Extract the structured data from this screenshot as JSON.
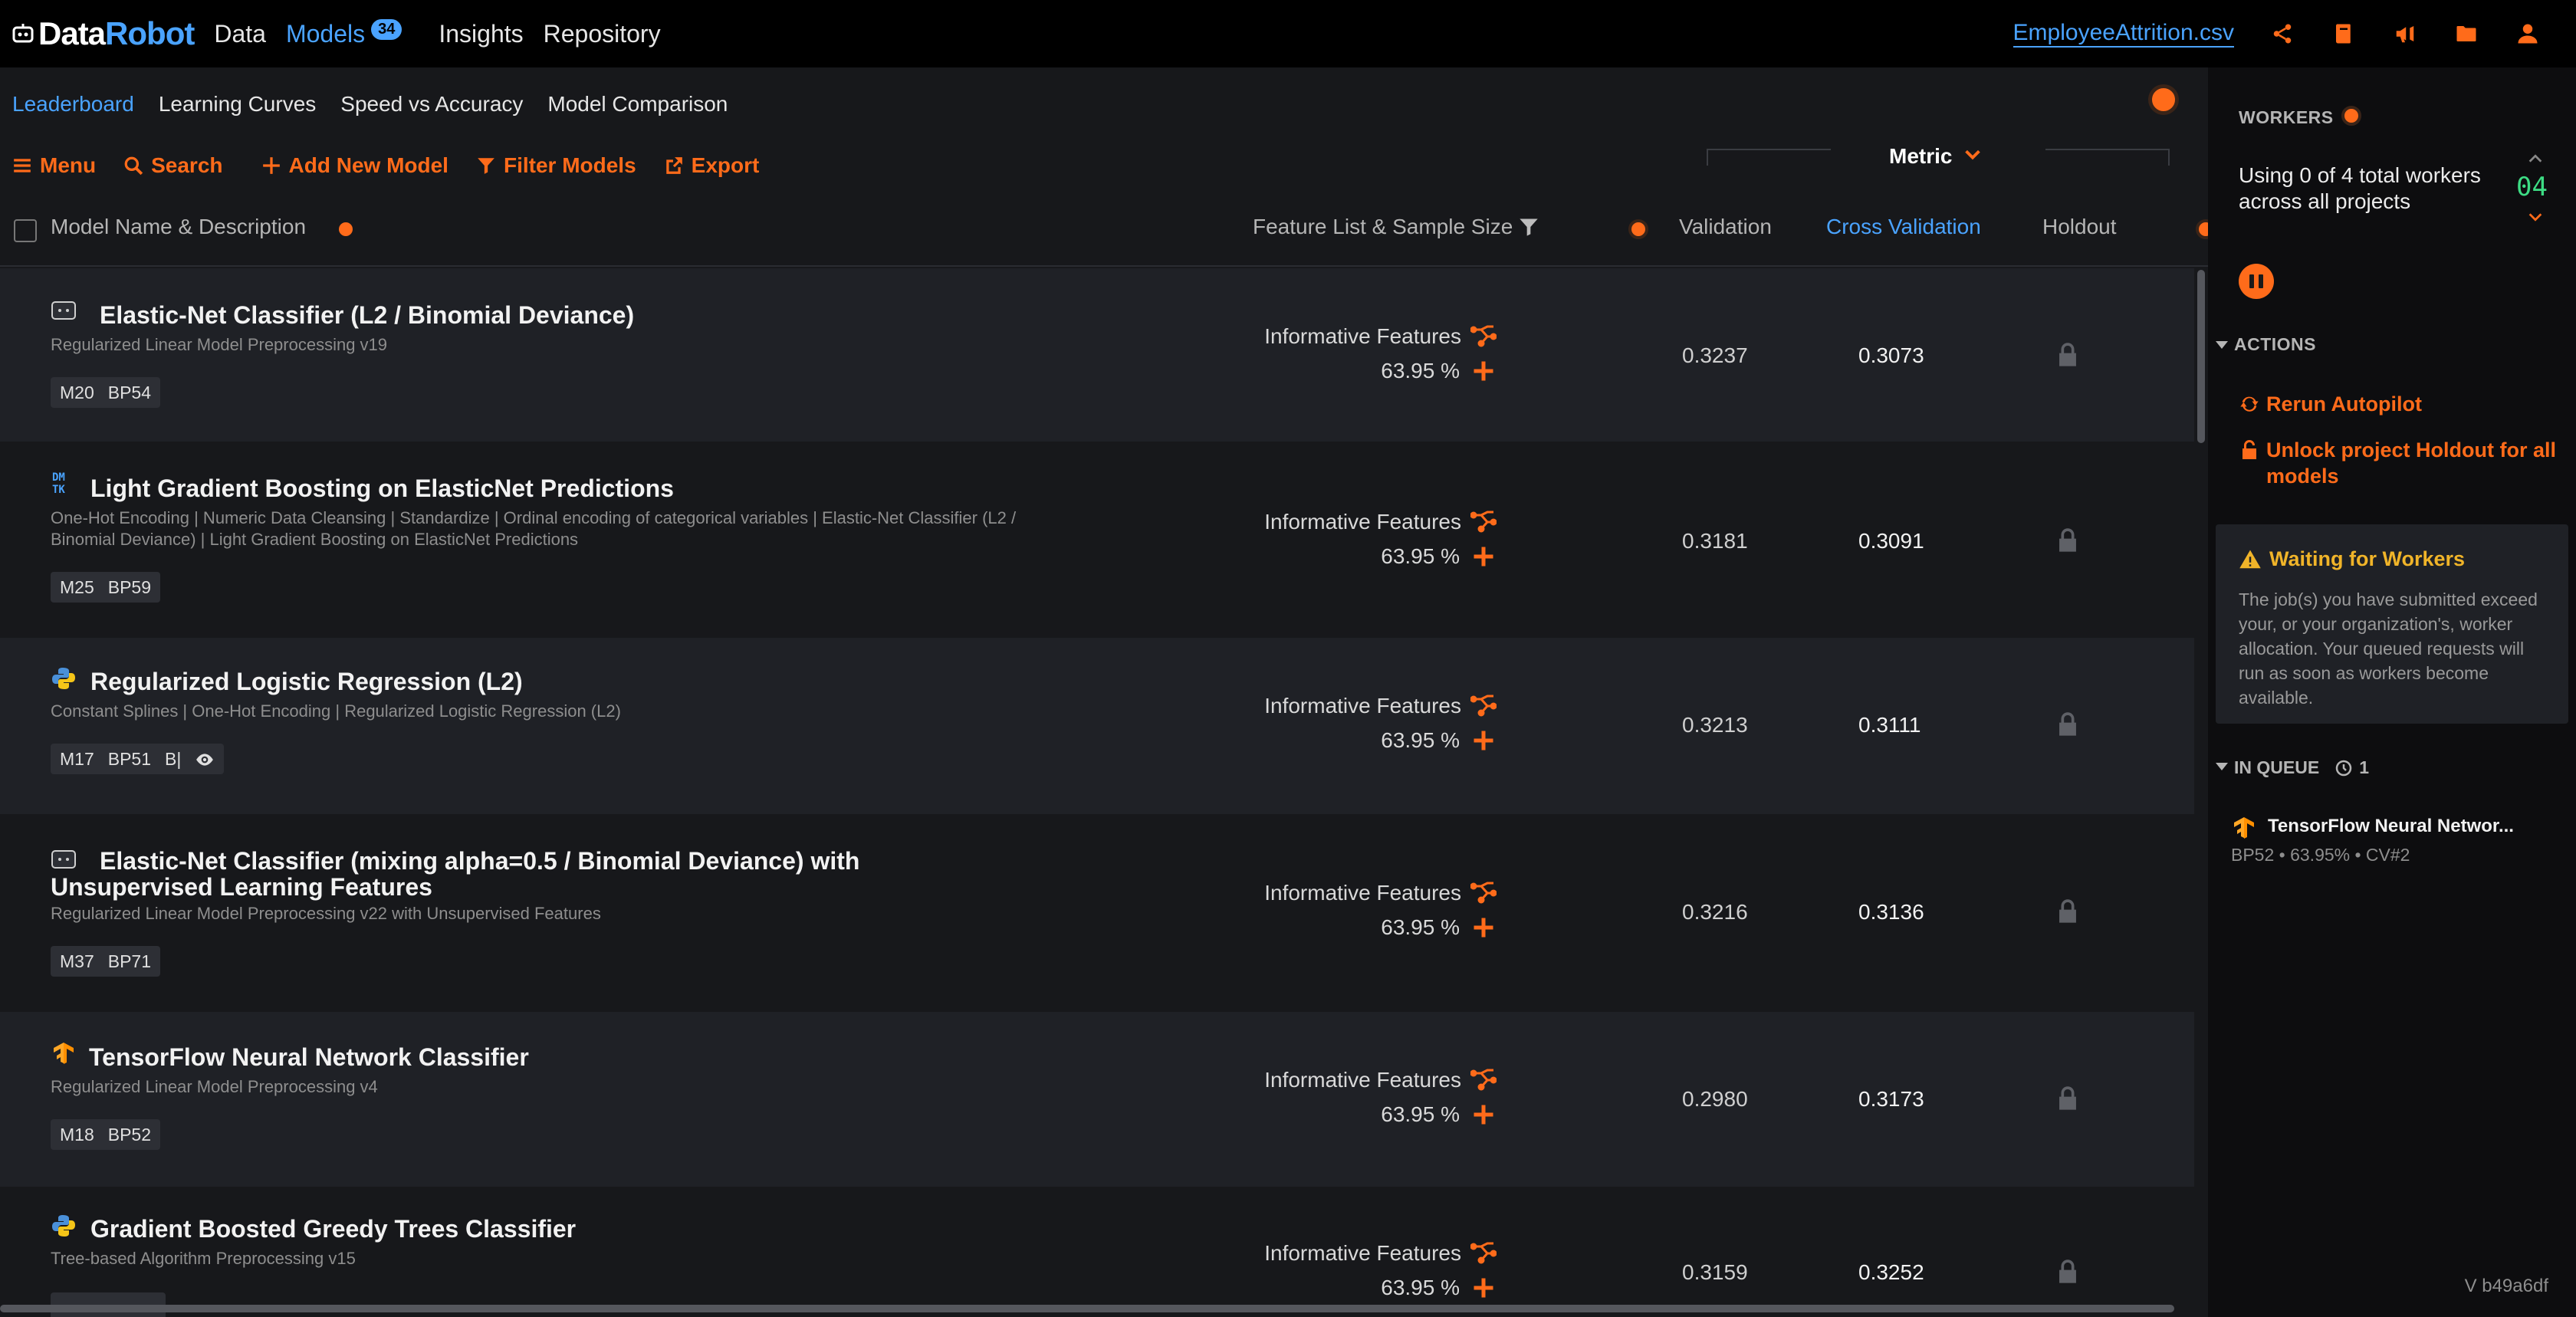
{
  "app": {
    "logo_part1": "Data",
    "logo_part2": "Robot",
    "nav": [
      {
        "label": "Data"
      },
      {
        "label": "Models",
        "badge": "34"
      },
      {
        "label": "Insights"
      },
      {
        "label": "Repository"
      }
    ],
    "project_name": "EmployeeAttrition.csv",
    "top_icons": [
      "share-icon",
      "book-icon",
      "megaphone-icon",
      "folder-icon",
      "user-icon"
    ]
  },
  "subtabs": [
    "Leaderboard",
    "Learning Curves",
    "Speed vs Accuracy",
    "Model Comparison"
  ],
  "toolbar": {
    "menu": "Menu",
    "search": "Search",
    "add_model": "Add New Model",
    "filter": "Filter Models",
    "export": "Export",
    "metric": "Metric"
  },
  "table": {
    "headers": {
      "name": "Model Name & Description",
      "feature": "Feature List & Sample Size",
      "validation": "Validation",
      "cross_validation": "Cross Validation",
      "holdout": "Holdout"
    },
    "rows": [
      {
        "icon": "blueprint-icon",
        "name": "Elastic-Net Classifier (L2 / Binomial Deviance)",
        "description": "Regularized Linear Model Preprocessing v19",
        "tags": [
          "M20",
          "BP54"
        ],
        "feature_list": "Informative Features",
        "sample": "63.95 %",
        "validation": "0.3237",
        "cv": "0.3073"
      },
      {
        "icon": "dmtk-icon",
        "name": "Light Gradient Boosting on ElasticNet Predictions",
        "description": "One-Hot Encoding | Numeric Data Cleansing | Standardize | Ordinal encoding of categorical variables | Elastic-Net Classifier (L2 / Binomial Deviance) | Light Gradient Boosting on ElasticNet Predictions",
        "tags": [
          "M25",
          "BP59"
        ],
        "feature_list": "Informative Features",
        "sample": "63.95 %",
        "validation": "0.3181",
        "cv": "0.3091"
      },
      {
        "icon": "python-icon",
        "name": "Regularized Logistic Regression (L2)",
        "description": "Constant Splines | One-Hot Encoding | Regularized Logistic Regression (L2)",
        "tags": [
          "M17",
          "BP51",
          "B|"
        ],
        "feature_list": "Informative Features",
        "sample": "63.95 %",
        "validation": "0.3213",
        "cv": "0.3111"
      },
      {
        "icon": "blueprint-icon",
        "name": "Elastic-Net Classifier (mixing alpha=0.5 / Binomial Deviance) with Unsupervised Learning Features",
        "description": "Regularized Linear Model Preprocessing v22 with Unsupervised Features",
        "tags": [
          "M37",
          "BP71"
        ],
        "feature_list": "Informative Features",
        "sample": "63.95 %",
        "validation": "0.3216",
        "cv": "0.3136"
      },
      {
        "icon": "tensorflow-icon",
        "name": "TensorFlow Neural Network Classifier",
        "description": "Regularized Linear Model Preprocessing v4",
        "tags": [
          "M18",
          "BP52"
        ],
        "feature_list": "Informative Features",
        "sample": "63.95 %",
        "validation": "0.2980",
        "cv": "0.3173"
      },
      {
        "icon": "python-icon",
        "name": "Gradient Boosted Greedy Trees Classifier",
        "description": "Tree-based Algorithm Preprocessing v15",
        "tags": [],
        "feature_list": "Informative Features",
        "sample": "63.95 %",
        "validation": "0.3159",
        "cv": "0.3252"
      }
    ]
  },
  "sidebar": {
    "workers_title": "WORKERS",
    "workers_text": "Using 0 of 4 total workers across all projects",
    "worker_count": "04",
    "actions_title": "ACTIONS",
    "actions": [
      "Rerun Autopilot",
      "Unlock project Holdout for all models"
    ],
    "warning_title": "Waiting for Workers",
    "warning_text": "The job(s) you have submitted exceed your, or your organization's, worker allocation. Your queued requests will run as soon as workers become available.",
    "queue_title": "IN QUEUE",
    "queue_count": "1",
    "queue_item_name": "TensorFlow Neural Networ...",
    "queue_item_meta": "BP52 • 63.95% • CV#2",
    "version": "V b49a6df"
  },
  "colors": {
    "accent": "#ff6b1a",
    "link": "#4aa3ff",
    "warning": "#f0b429",
    "worker_count": "#3ddc84"
  }
}
